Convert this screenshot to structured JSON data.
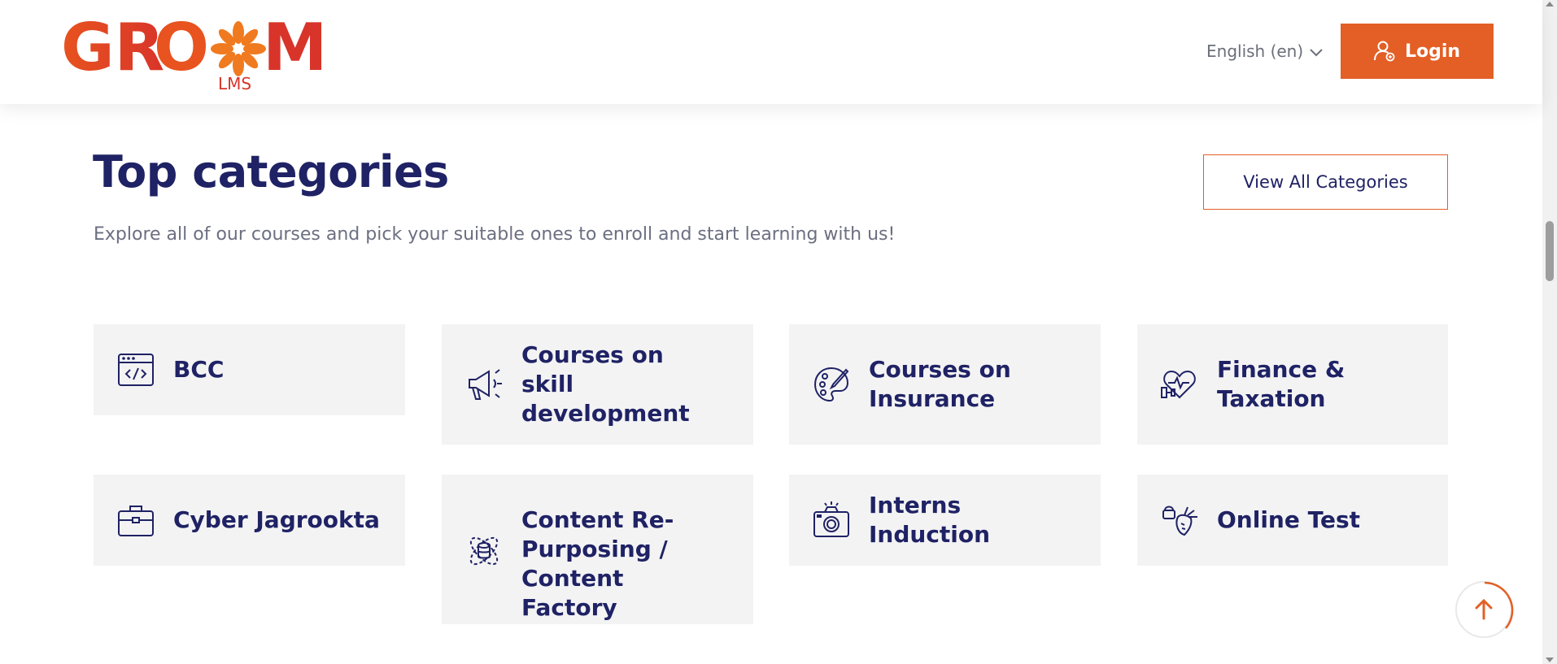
{
  "header": {
    "logo_text": "GROOM",
    "logo_sub": "LMS",
    "language": "English (en)",
    "login_label": "Login"
  },
  "section": {
    "title": "Top categories",
    "subtitle": "Explore all of our courses and pick your suitable ones to enroll and start learning with us!",
    "view_all_label": "View All Categories"
  },
  "categories": [
    {
      "label": "BCC",
      "icon": "code-window-icon"
    },
    {
      "label": "Courses on skill development",
      "icon": "megaphone-icon"
    },
    {
      "label": "Courses on Insurance",
      "icon": "palette-icon"
    },
    {
      "label": "Finance & Taxation",
      "icon": "heart-dumbbell-icon"
    },
    {
      "label": "Cyber Jagrookta",
      "icon": "briefcase-icon"
    },
    {
      "label": "Content Re-Purposing / Content Factory",
      "icon": "atom-database-icon"
    },
    {
      "label": "Interns Induction",
      "icon": "camera-icon"
    },
    {
      "label": "Online Test",
      "icon": "fruit-basket-icon"
    }
  ],
  "colors": {
    "accent": "#e35f25",
    "heading": "#1f2264",
    "card_bg": "#f3f3f4"
  }
}
